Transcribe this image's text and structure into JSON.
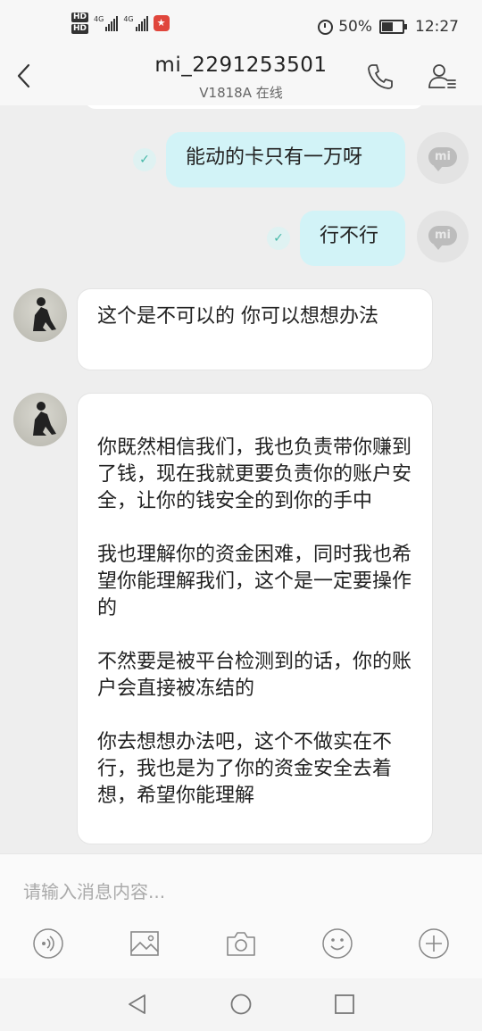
{
  "status_bar": {
    "hd1": "HD",
    "hd2": "HD",
    "net1": "4G",
    "net2": "4G",
    "battery": "50%",
    "time": "12:27"
  },
  "header": {
    "title": "mi_2291253501",
    "subtitle": "V1818A 在线"
  },
  "messages": [
    {
      "side": "out",
      "text": "能动的卡只有一万呀"
    },
    {
      "side": "out",
      "text": "行不行"
    },
    {
      "side": "in",
      "paragraphs": [
        "这个是不可以的   你可以想想办法"
      ]
    },
    {
      "side": "in",
      "paragraphs": [
        "你既然相信我们，我也负责带你赚到了钱，现在我就更要负责你的账户安全，让你的钱安全的到你的手中",
        "我也理解你的资金困难，同时我也希望你能理解我们，这个是一定要操作的",
        "不然要是被平台检测到的话，你的账户会直接被冻结的",
        "你去想想办法吧，这个不做实在不行，我也是为了你的资金安全去着想，希望你能理解"
      ]
    }
  ],
  "avatar_label": "mi",
  "input": {
    "placeholder": "请输入消息内容..."
  },
  "icons": {
    "back": "chevron-left-icon",
    "call": "phone-icon",
    "profile": "user-info-icon",
    "voice": "voice-icon",
    "image": "image-icon",
    "camera": "camera-icon",
    "emoji": "emoji-icon",
    "add": "plus-icon"
  },
  "colors": {
    "outgoing_bubble": "#d2f3f7",
    "incoming_bubble": "#ffffff",
    "background": "#eeeeee"
  }
}
